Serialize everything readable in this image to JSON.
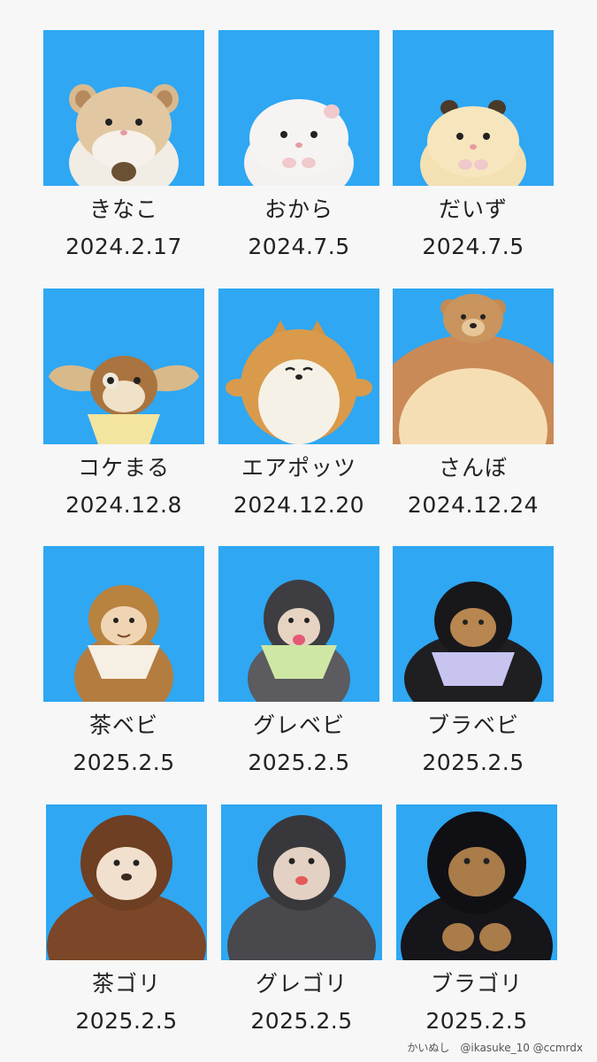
{
  "items": [
    {
      "name": "きなこ",
      "date": "2024.2.17",
      "icon": "hamster-beige-icon"
    },
    {
      "name": "おから",
      "date": "2024.7.5",
      "icon": "hamster-white-icon"
    },
    {
      "name": "だいず",
      "date": "2024.7.5",
      "icon": "hamster-cream-icon"
    },
    {
      "name": "コケまる",
      "date": "2024.12.8",
      "icon": "gremlin-plush-icon"
    },
    {
      "name": "エアポッツ",
      "date": "2024.12.20",
      "icon": "shiba-dog-plush-icon"
    },
    {
      "name": "さんぼ",
      "date": "2024.12.24",
      "icon": "bear-on-cushion-icon"
    },
    {
      "name": "茶ベビ",
      "date": "2025.2.5",
      "icon": "baby-monkey-brown-icon"
    },
    {
      "name": "グレベビ",
      "date": "2025.2.5",
      "icon": "baby-gorilla-gray-icon"
    },
    {
      "name": "ブラベビ",
      "date": "2025.2.5",
      "icon": "baby-gorilla-black-icon"
    },
    {
      "name": "茶ゴリ",
      "date": "2025.2.5",
      "icon": "gorilla-brown-icon"
    },
    {
      "name": "グレゴリ",
      "date": "2025.2.5",
      "icon": "gorilla-gray-icon"
    },
    {
      "name": "ブラゴリ",
      "date": "2025.2.5",
      "icon": "gorilla-black-icon"
    }
  ],
  "credit": "かいぬし　@ikasuke_10 @ccmrdx",
  "colors": {
    "photo_bg": "#2fa7f3",
    "page_bg": "#f7f7f7",
    "text": "#222222"
  }
}
